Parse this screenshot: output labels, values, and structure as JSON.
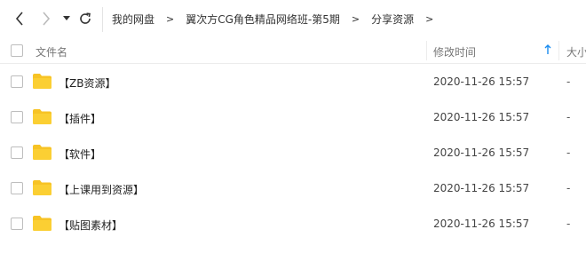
{
  "breadcrumb": [
    "我的网盘",
    "翼次方CG角色精品网络班-第5期",
    "分享资源"
  ],
  "breadcrumb_separator": ">",
  "columns": {
    "name": "文件名",
    "modified": "修改时间",
    "size": "大小"
  },
  "sort_indicator_color": "#1a8cf0",
  "folder_color": "#f7c325",
  "rows": [
    {
      "name": "【ZB资源】",
      "modified": "2020-11-26 15:57",
      "size": "-"
    },
    {
      "name": "【插件】",
      "modified": "2020-11-26 15:57",
      "size": "-"
    },
    {
      "name": "【软件】",
      "modified": "2020-11-26 15:57",
      "size": "-"
    },
    {
      "name": "【上课用到资源】",
      "modified": "2020-11-26 15:57",
      "size": "-"
    },
    {
      "name": "【贴图素材】",
      "modified": "2020-11-26 15:57",
      "size": "-"
    }
  ]
}
